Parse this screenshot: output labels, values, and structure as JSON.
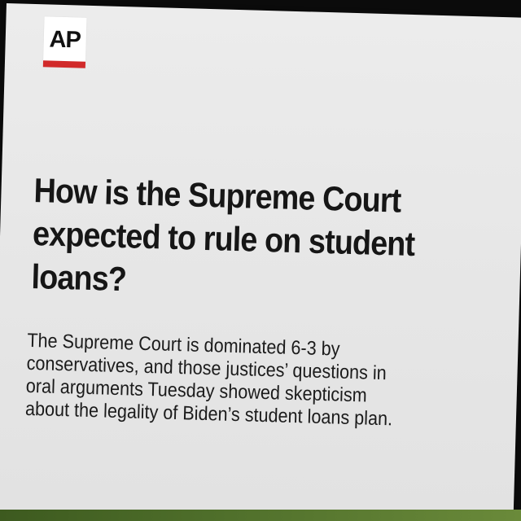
{
  "logo": {
    "text": "AP"
  },
  "headline": "How is the Supreme Court expected to rule on student loans?",
  "body": "The Supreme Court is dominated 6-3 by conservatives, and those justices’ questions in oral arguments Tuesday showed skepticism about the legality of Biden’s student loans plan.",
  "colors": {
    "logo_bar": "#d12a2a",
    "card_background": "#e8e8e8",
    "bottom_strip": "#4e6e2a"
  }
}
